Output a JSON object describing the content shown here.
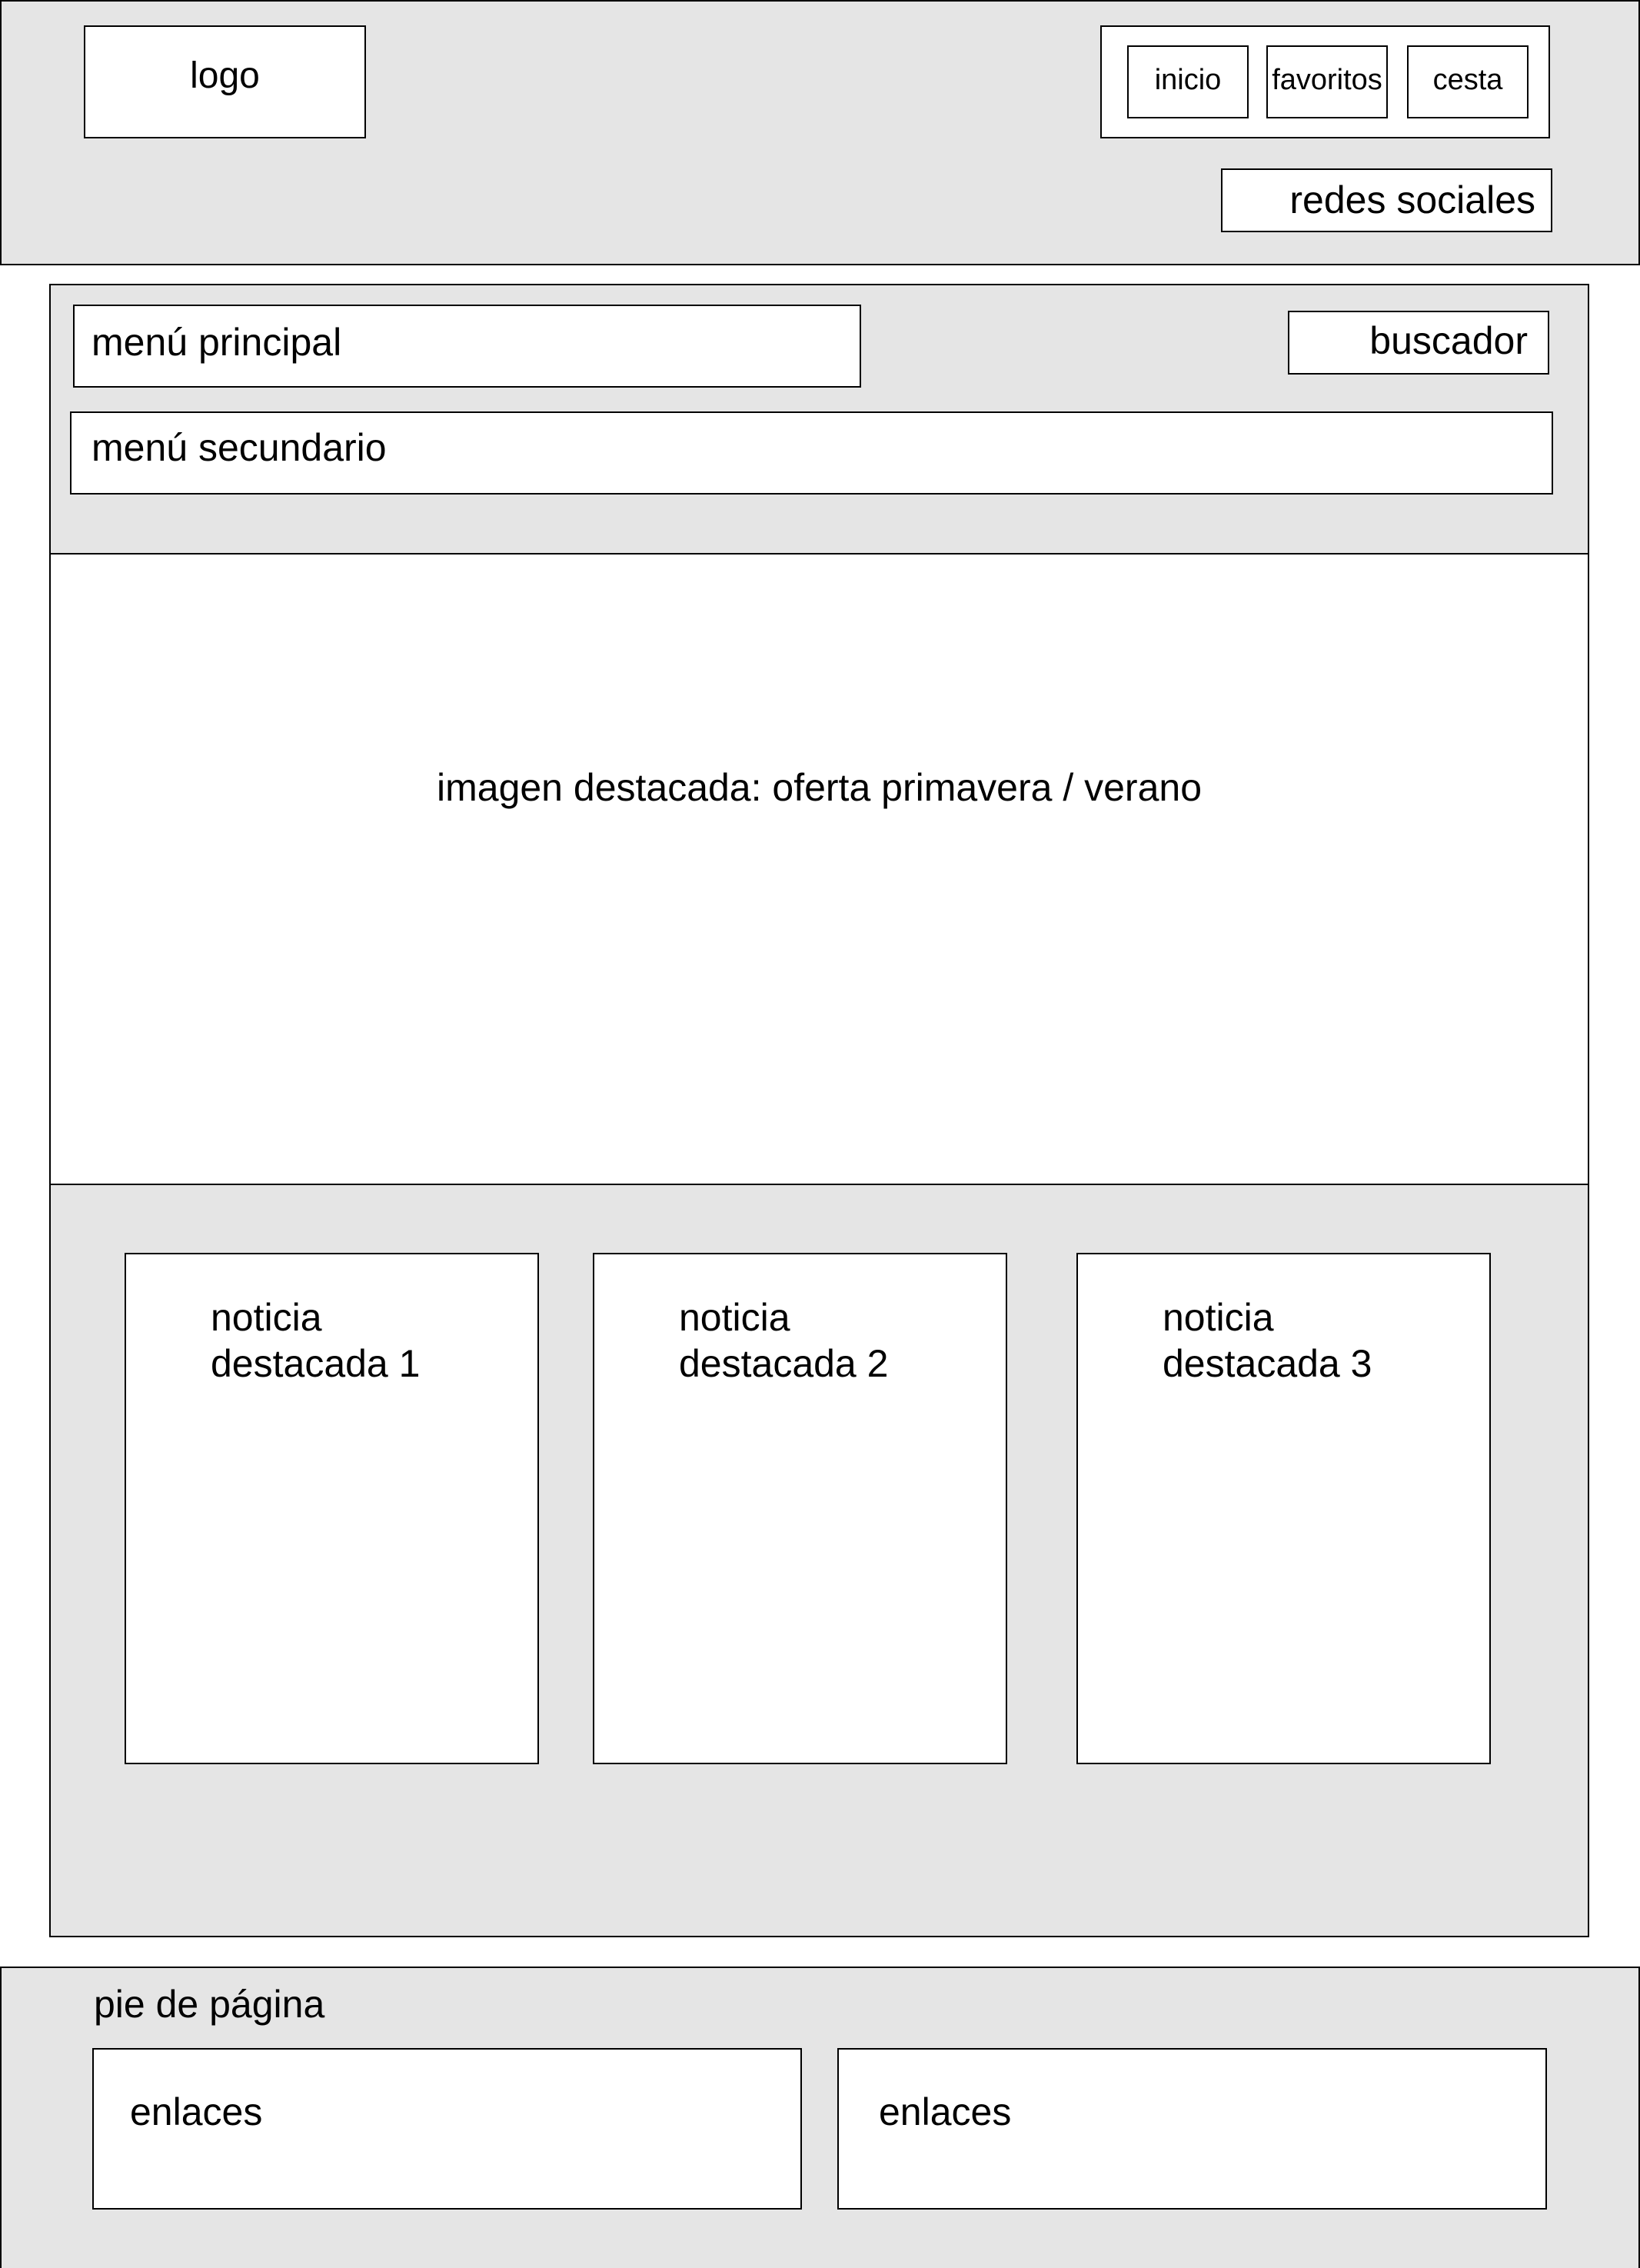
{
  "header": {
    "logo": "logo",
    "nav": [
      "inicio",
      "favoritos",
      "cesta"
    ],
    "social": "redes sociales"
  },
  "main": {
    "menu_principal": "menú principal",
    "buscador": "buscador",
    "menu_secundario": "menú secundario",
    "hero": "imagen destacada: oferta primavera / verano",
    "news": [
      "noticia\ndestacada 1",
      "noticia\ndestacada 2",
      "noticia\ndestacada 3"
    ]
  },
  "footer": {
    "title": "pie de página",
    "links": [
      "enlaces",
      "enlaces"
    ]
  }
}
